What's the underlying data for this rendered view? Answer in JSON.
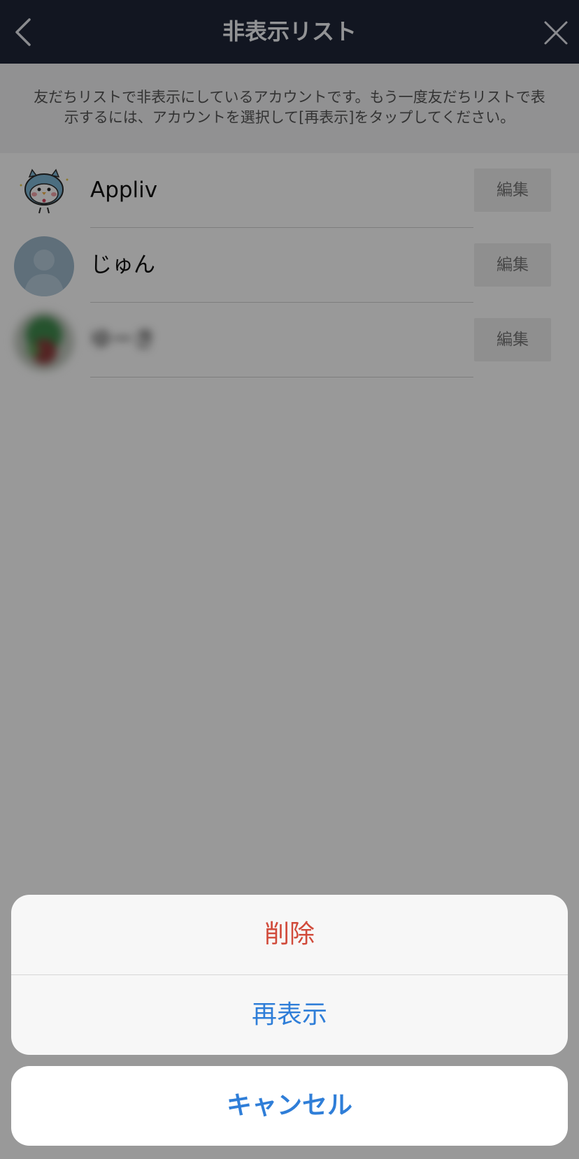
{
  "header": {
    "title": "非表示リスト",
    "back_icon": "chevron-left-icon",
    "close_icon": "close-icon"
  },
  "notice": {
    "text": "友だちリストで非表示にしているアカウントです。もう一度友だちリストで表示するには、アカウントを選択して[再表示]をタップしてください。"
  },
  "list": {
    "items": [
      {
        "name": "Appliv",
        "edit_label": "編集",
        "avatar": "owl-mascot-avatar"
      },
      {
        "name": "じゅん",
        "edit_label": "編集",
        "avatar": "default-person-avatar"
      },
      {
        "name": "ゆーき",
        "edit_label": "編集",
        "avatar": "blurred-photo-avatar"
      }
    ]
  },
  "action_sheet": {
    "delete_label": "削除",
    "unhide_label": "再表示",
    "cancel_label": "キャンセル"
  },
  "colors": {
    "header_bg": "#1e2538",
    "destructive": "#d14b3b",
    "action_blue": "#2f7ed8"
  }
}
